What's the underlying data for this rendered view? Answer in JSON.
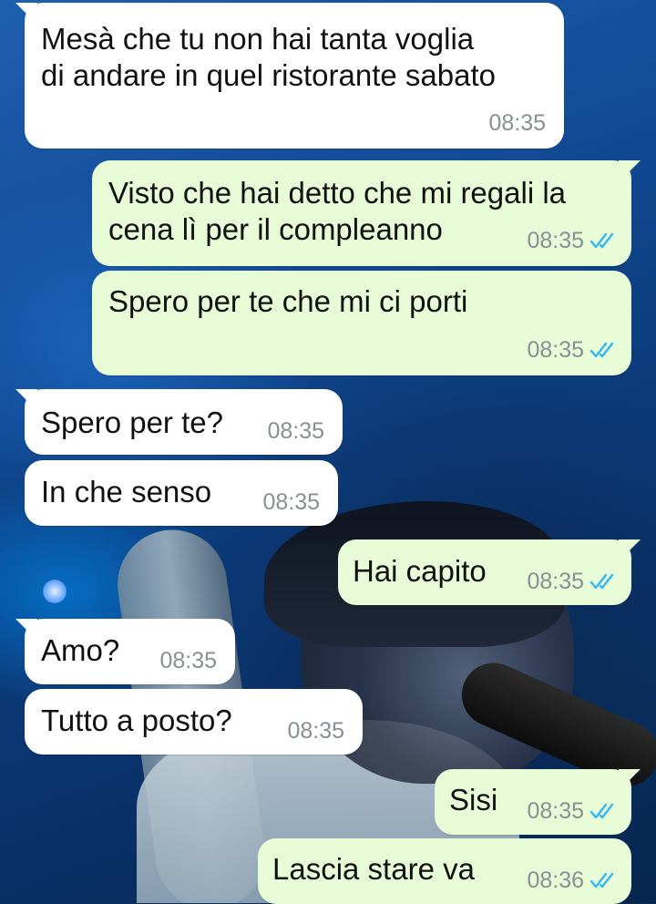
{
  "colors": {
    "incoming_bubble": "#ffffff",
    "outgoing_bubble": "#e7fcd7",
    "read_ticks": "#34b7f1",
    "time_text": "#8a8f93"
  },
  "messages": [
    {
      "direction": "in",
      "text": "Mesà che tu non hai tanta voglia\ndi andare in quel ristorante sabato",
      "time": "08:35"
    },
    {
      "direction": "out",
      "text": "Visto che hai detto che mi regali la\ncena lì per il compleanno",
      "time": "08:35",
      "status": "read"
    },
    {
      "direction": "out",
      "text": "Spero per te che mi ci porti",
      "time": "08:35",
      "status": "read"
    },
    {
      "direction": "in",
      "text": "Spero per te?",
      "time": "08:35"
    },
    {
      "direction": "in",
      "text": "In che senso",
      "time": "08:35"
    },
    {
      "direction": "out",
      "text": "Hai capito",
      "time": "08:35",
      "status": "read"
    },
    {
      "direction": "in",
      "text": "Amo?",
      "time": "08:35"
    },
    {
      "direction": "in",
      "text": "Tutto a posto?",
      "time": "08:35"
    },
    {
      "direction": "out",
      "text": "Sisi",
      "time": "08:35",
      "status": "read"
    },
    {
      "direction": "out",
      "text": "Lascia stare va",
      "time": "08:36",
      "status": "read"
    }
  ]
}
